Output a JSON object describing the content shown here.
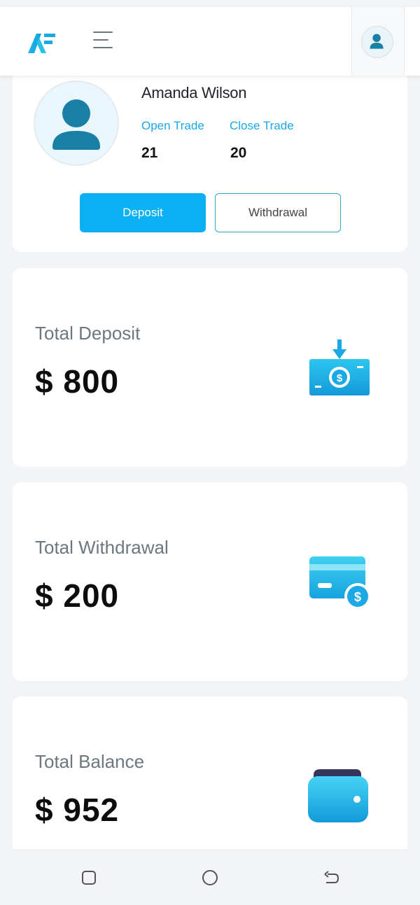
{
  "header": {
    "logo": "af-logo",
    "menu_icon": "hamburger-icon",
    "avatar_icon": "user-icon"
  },
  "profile": {
    "name": "Amanda Wilson",
    "open_trade_label": "Open Trade",
    "open_trade_value": "21",
    "close_trade_label": "Close Trade",
    "close_trade_value": "20",
    "deposit_label": "Deposit",
    "withdrawal_label": "Withdrawal"
  },
  "stats": [
    {
      "title": "Total Deposit",
      "amount": "$ 800",
      "icon": "money-deposit-icon"
    },
    {
      "title": "Total Withdrawal",
      "amount": "$ 200",
      "icon": "card-withdraw-icon"
    },
    {
      "title": "Total Balance",
      "amount": "$ 952",
      "icon": "wallet-icon"
    }
  ],
  "system_nav": {
    "recents": "square-icon",
    "home": "circle-icon",
    "back": "back-arrow-icon"
  },
  "colors": {
    "accent": "#0cb1f5",
    "link": "#1aa8e6",
    "avatar": "#1a7fa5"
  }
}
